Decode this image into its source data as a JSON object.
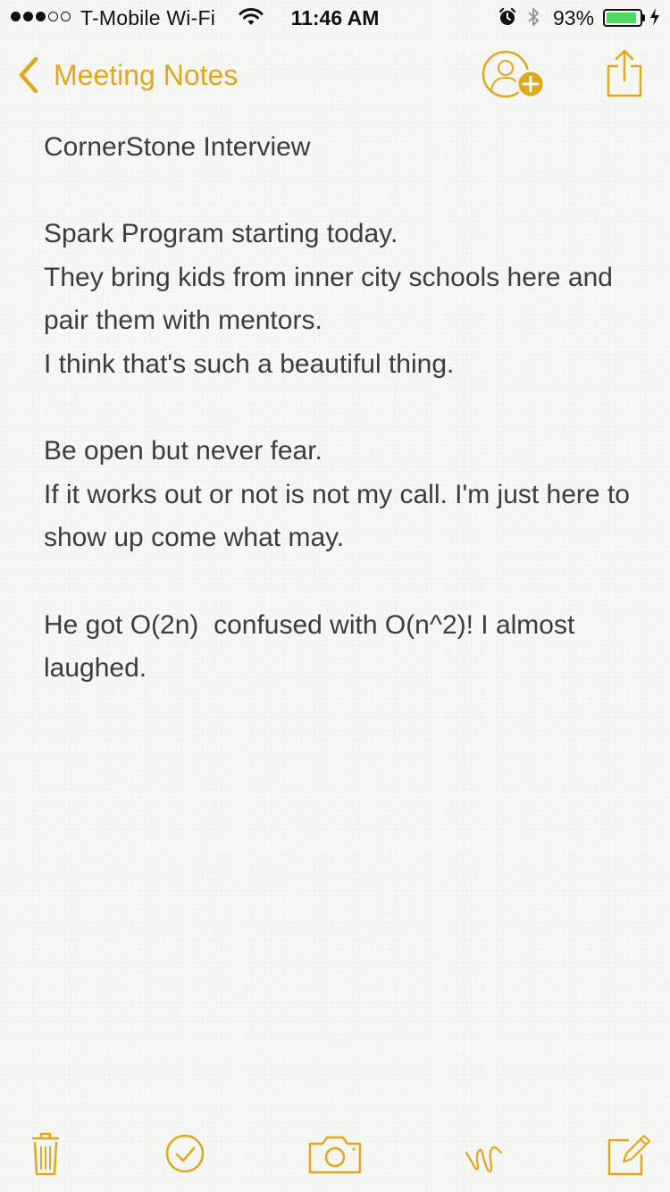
{
  "status_bar": {
    "signal_bars_filled": 3,
    "signal_bars_total": 5,
    "carrier": "T-Mobile Wi-Fi",
    "time": "11:46 AM",
    "battery_percent": "93%",
    "battery_level": 0.93,
    "battery_color": "#4cd964",
    "icons": [
      "wifi-icon",
      "alarm-icon",
      "bluetooth-icon",
      "battery-icon",
      "charging-icon"
    ]
  },
  "nav": {
    "back_label": "Meeting Notes",
    "accent_color": "#e1a71d",
    "icons": [
      "chevron-left-icon",
      "add-person-icon",
      "share-icon"
    ]
  },
  "note": {
    "title": "CornerStone Interview",
    "paragraphs": [
      [
        "Spark Program starting today.",
        "They bring kids from inner city schools here and pair them with mentors.",
        "I think that's such a beautiful thing."
      ],
      [
        "Be open but never fear.",
        "If it works out or not is not my call. I'm just here to show up come what may."
      ],
      [
        "He got O(2n)  confused with O(n^2)! I almost laughed."
      ]
    ]
  },
  "toolbar": {
    "items": [
      "trash-icon",
      "checklist-icon",
      "camera-icon",
      "sketch-icon",
      "compose-icon"
    ]
  }
}
